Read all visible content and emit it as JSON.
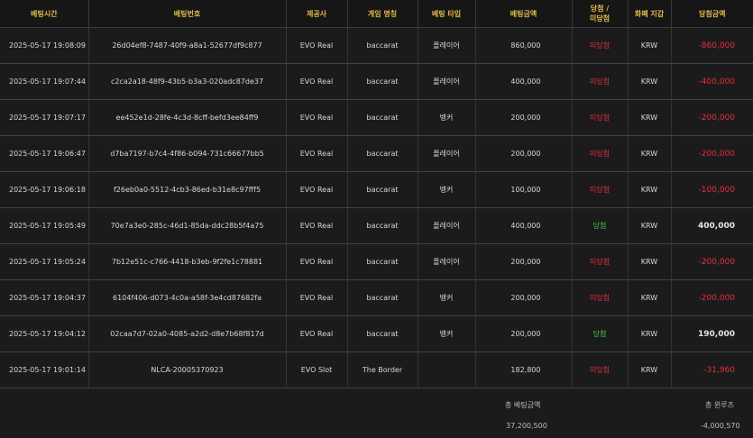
{
  "table": {
    "headers": {
      "bet_time": "베팅시간",
      "bet_id": "베팅번호",
      "provider": "제공사",
      "game_name": "게임 명칭",
      "bet_type": "베팅 타입",
      "bet_amount": "베팅금액",
      "result_line1": "당첨 /",
      "result_line2": "미당첨",
      "currency": "화폐 지갑",
      "payout": "당첨금액"
    },
    "rows": [
      {
        "time": "2025-05-17 19:08:09",
        "id": "26d04ef8-7487-40f9-a8a1-52677df9c877",
        "provider": "EVO Real",
        "game": "baccarat",
        "type": "플레이어",
        "amount": "860,000",
        "result": "미당첨",
        "result_status": "lose",
        "currency": "KRW",
        "payout": "-860,000",
        "payout_sign": "negative"
      },
      {
        "time": "2025-05-17 19:07:44",
        "id": "c2ca2a18-48f9-43b5-b3a3-020adc87de37",
        "provider": "EVO Real",
        "game": "baccarat",
        "type": "플레이어",
        "amount": "400,000",
        "result": "미당첨",
        "result_status": "lose",
        "currency": "KRW",
        "payout": "-400,000",
        "payout_sign": "negative"
      },
      {
        "time": "2025-05-17 19:07:17",
        "id": "ee452e1d-28fe-4c3d-8cff-befd3ee84ff9",
        "provider": "EVO Real",
        "game": "baccarat",
        "type": "뱅커",
        "amount": "200,000",
        "result": "미당첨",
        "result_status": "lose",
        "currency": "KRW",
        "payout": "-200,000",
        "payout_sign": "negative"
      },
      {
        "time": "2025-05-17 19:06:47",
        "id": "d7ba7197-b7c4-4f86-b094-731c66677bb5",
        "provider": "EVO Real",
        "game": "baccarat",
        "type": "플레이어",
        "amount": "200,000",
        "result": "미당첨",
        "result_status": "lose",
        "currency": "KRW",
        "payout": "-200,000",
        "payout_sign": "negative"
      },
      {
        "time": "2025-05-17 19:06:18",
        "id": "f26eb0a0-5512-4cb3-86ed-b31e8c97fff5",
        "provider": "EVO Real",
        "game": "baccarat",
        "type": "뱅커",
        "amount": "100,000",
        "result": "미당첨",
        "result_status": "lose",
        "currency": "KRW",
        "payout": "-100,000",
        "payout_sign": "negative"
      },
      {
        "time": "2025-05-17 19:05:49",
        "id": "70e7a3e0-285c-46d1-85da-ddc28b5f4a75",
        "provider": "EVO Real",
        "game": "baccarat",
        "type": "플레이어",
        "amount": "400,000",
        "result": "당첨",
        "result_status": "win",
        "currency": "KRW",
        "payout": "400,000",
        "payout_sign": "positive"
      },
      {
        "time": "2025-05-17 19:05:24",
        "id": "7b12e51c-c766-4418-b3eb-9f2fe1c78881",
        "provider": "EVO Real",
        "game": "baccarat",
        "type": "플레이어",
        "amount": "200,000",
        "result": "미당첨",
        "result_status": "lose",
        "currency": "KRW",
        "payout": "-200,000",
        "payout_sign": "negative"
      },
      {
        "time": "2025-05-17 19:04:37",
        "id": "6104f406-d073-4c0a-a58f-3e4cd87682fa",
        "provider": "EVO Real",
        "game": "baccarat",
        "type": "뱅커",
        "amount": "200,000",
        "result": "미당첨",
        "result_status": "lose",
        "currency": "KRW",
        "payout": "-200,000",
        "payout_sign": "negative"
      },
      {
        "time": "2025-05-17 19:04:12",
        "id": "02caa7d7-02a0-4085-a2d2-d8e7b68f817d",
        "provider": "EVO Real",
        "game": "baccarat",
        "type": "뱅커",
        "amount": "200,000",
        "result": "당첨",
        "result_status": "win",
        "currency": "KRW",
        "payout": "190,000",
        "payout_sign": "positive"
      },
      {
        "time": "2025-05-17 19:01:14",
        "id": "NLCA-20005370923",
        "provider": "EVO Slot",
        "game": "The Border",
        "type": "",
        "amount": "182,800",
        "result": "미당첨",
        "result_status": "lose",
        "currency": "KRW",
        "payout": "-31,960",
        "payout_sign": "negative"
      }
    ]
  },
  "summary": {
    "total_bet_label": "총 베팅금액",
    "total_bet_value": "37,200,500",
    "win_loss_label": "총 윈루즈",
    "win_loss_value": "-4,000,570"
  },
  "colors": {
    "header_text": "#e0b84c",
    "lose": "#e5303a",
    "win": "#3fcf4e",
    "background": "#1b1b1b"
  }
}
